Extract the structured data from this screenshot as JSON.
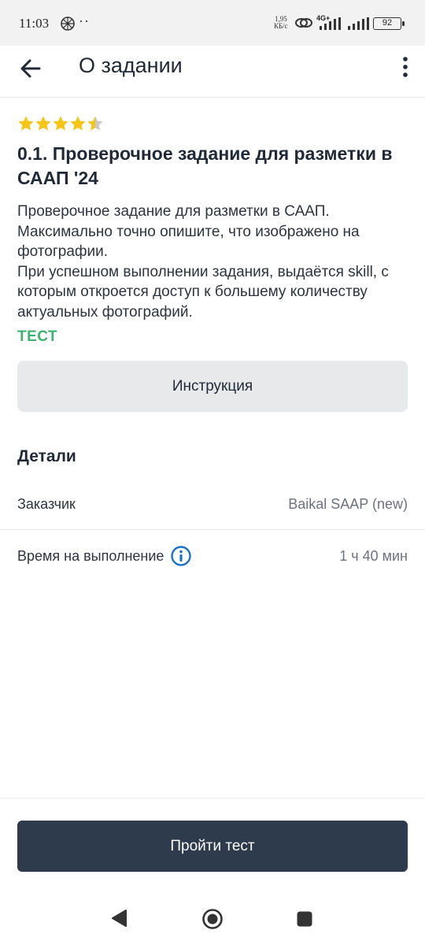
{
  "status_bar": {
    "time": "11:03",
    "dots": "··",
    "speed_value": "1,95",
    "speed_unit": "КБ/с",
    "network": "4G+",
    "battery": "92"
  },
  "app_bar": {
    "title": "О задании",
    "back_icon": "arrow-left-icon",
    "menu_icon": "more-vertical-icon"
  },
  "task": {
    "rating": 4.5,
    "rating_max": 5,
    "star_color": "#f5c518",
    "title": "0.1. Проверочное задание для разметки в СААП '24",
    "description": "Проверочное задание для разметки в СААП.\nМаксимально точно опишите, что изображено на фотографии.\nПри успешном выполнении задания, выдаётся skill, с которым откроется доступ к большему количеству актуальных фотографий.",
    "badge": "ТЕСТ",
    "badge_color": "#3cb371"
  },
  "instruction_button": "Инструкция",
  "details": {
    "heading": "Детали",
    "rows": [
      {
        "label": "Заказчик",
        "value": "Baikal SAAP (new)"
      },
      {
        "label": "Время на выполнение",
        "value": "1 ч 40 мин",
        "icon": "info-icon"
      }
    ]
  },
  "primary_button": "Пройти тест",
  "colors": {
    "primary": "#2d3b4c",
    "info_icon": "#1a73c8"
  }
}
